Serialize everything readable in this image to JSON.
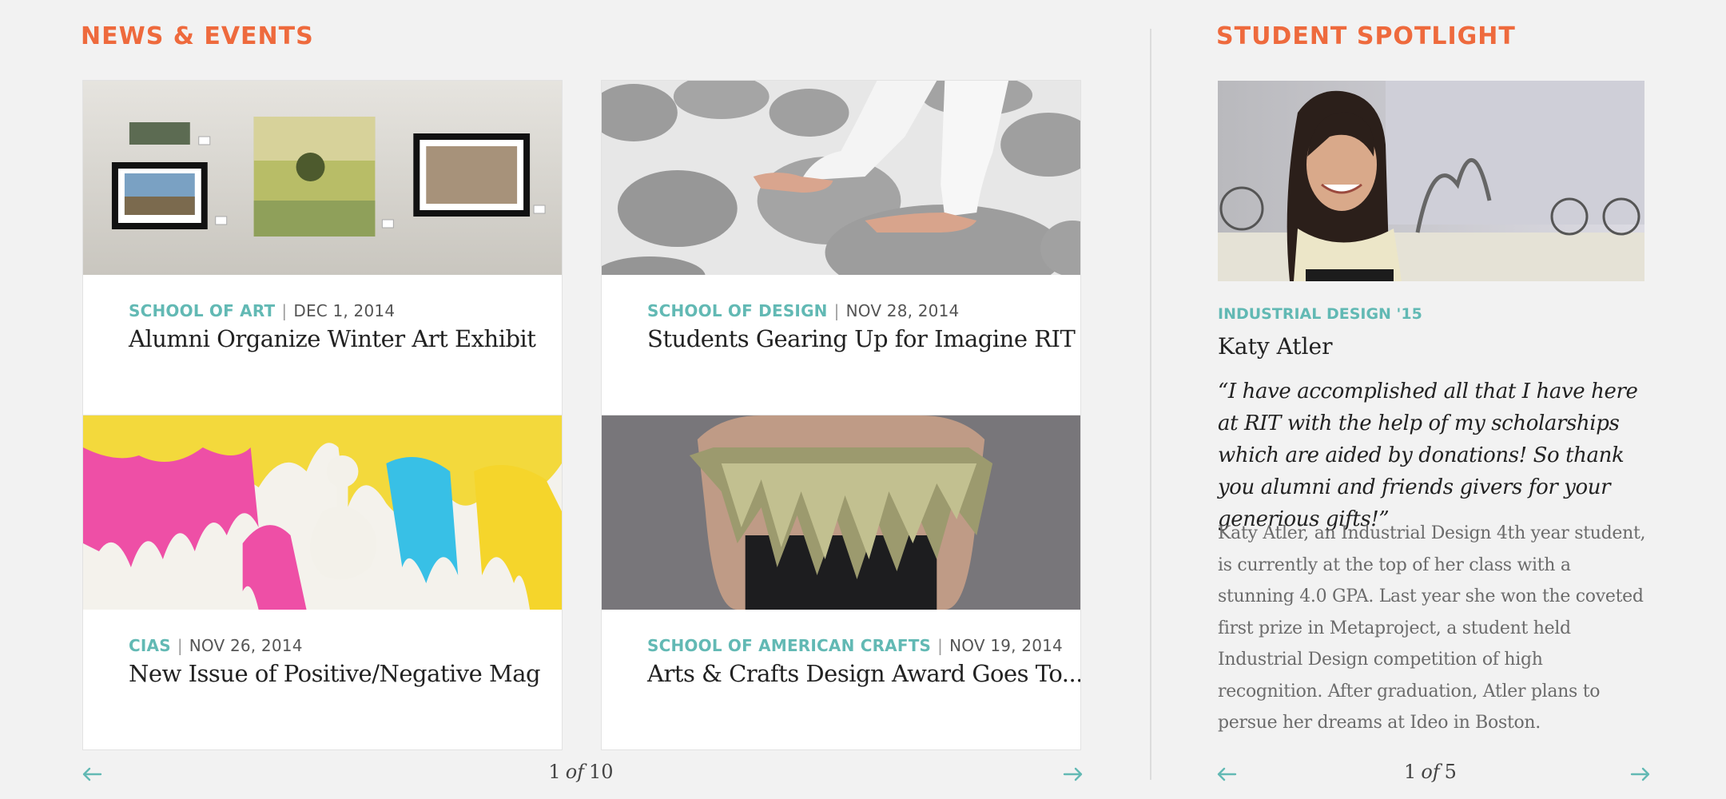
{
  "news": {
    "heading": "NEWS & EVENTS",
    "cards": [
      {
        "category": "SCHOOL OF ART",
        "date": "DEC 1, 2014",
        "title": "Alumni Organize Winter Art Exhibit"
      },
      {
        "category": "SCHOOL OF DESIGN",
        "date": "NOV 28, 2014",
        "title": "Students Gearing Up for Imagine RIT"
      },
      {
        "category": "CIAS",
        "date": "NOV 26, 2014",
        "title": "New Issue of Positive/Negative Mag"
      },
      {
        "category": "SCHOOL OF AMERICAN CRAFTS",
        "date": "NOV 19, 2014",
        "title": "Arts & Crafts Design Award Goes To..."
      }
    ],
    "pager": {
      "current": "1",
      "of": "of",
      "total": "10"
    }
  },
  "spotlight": {
    "heading": "STUDENT SPOTLIGHT",
    "program": "INDUSTRIAL DESIGN '15",
    "name": "Katy Atler",
    "quote": "“I have accomplished all that I have here at RIT with the help of my scholarships which are aided by donations! So thank you alumni and friends givers for your generious gifts!”",
    "bio": "Katy Atler, an Industrial Design 4th year student, is currently at the top of her class with a stunning 4.0 GPA. Last year she won the coveted first prize in Metaproject, a student held Industrial Design competition of high recognition. After graduation, Atler plans to persue her dreams at Ideo in Boston.",
    "pager": {
      "current": "1",
      "of": "of",
      "total": "5"
    }
  },
  "colors": {
    "accent": "#ee6a3d",
    "teal": "#62b9b4",
    "background": "#f2f2f2"
  },
  "icons": {
    "prev": "arrow-left-icon",
    "next": "arrow-right-icon"
  }
}
